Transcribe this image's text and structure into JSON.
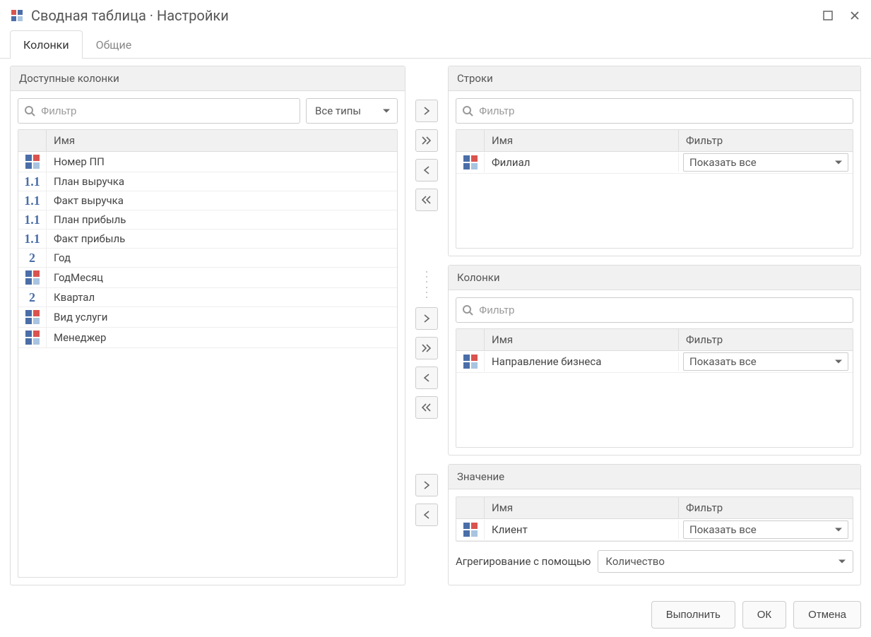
{
  "window": {
    "title": "Сводная таблица · Настройки"
  },
  "tabs": {
    "columns": "Колонки",
    "general": "Общие"
  },
  "available": {
    "header": "Доступные колонки",
    "filter_placeholder": "Фильтр",
    "type_select": "Все типы",
    "name_header": "Имя",
    "items": [
      {
        "icon": "squares",
        "name": "Номер ПП"
      },
      {
        "icon": "num11",
        "name": "План выручка"
      },
      {
        "icon": "num11",
        "name": "Факт выручка"
      },
      {
        "icon": "num11",
        "name": "План прибыль"
      },
      {
        "icon": "num11",
        "name": "Факт прибыль"
      },
      {
        "icon": "num2",
        "name": "Год"
      },
      {
        "icon": "squares",
        "name": "ГодМесяц"
      },
      {
        "icon": "num2",
        "name": "Квартал"
      },
      {
        "icon": "squares",
        "name": "Вид услуги"
      },
      {
        "icon": "squares",
        "name": "Менеджер"
      }
    ]
  },
  "rows": {
    "header": "Строки",
    "filter_placeholder": "Фильтр",
    "name_header": "Имя",
    "filter_header": "Фильтр",
    "items": [
      {
        "icon": "squares",
        "name": "Филиал",
        "filter": "Показать все"
      }
    ]
  },
  "columns": {
    "header": "Колонки",
    "filter_placeholder": "Фильтр",
    "name_header": "Имя",
    "filter_header": "Фильтр",
    "items": [
      {
        "icon": "squares",
        "name": "Направление бизнеса",
        "filter": "Показать все"
      }
    ]
  },
  "value": {
    "header": "Значение",
    "name_header": "Имя",
    "filter_header": "Фильтр",
    "items": [
      {
        "icon": "squares",
        "name": "Клиент",
        "filter": "Показать все"
      }
    ],
    "aggr_label": "Агрегирование с помощью",
    "aggr_value": "Количество"
  },
  "footer": {
    "execute": "Выполнить",
    "ok": "ОК",
    "cancel": "Отмена"
  }
}
